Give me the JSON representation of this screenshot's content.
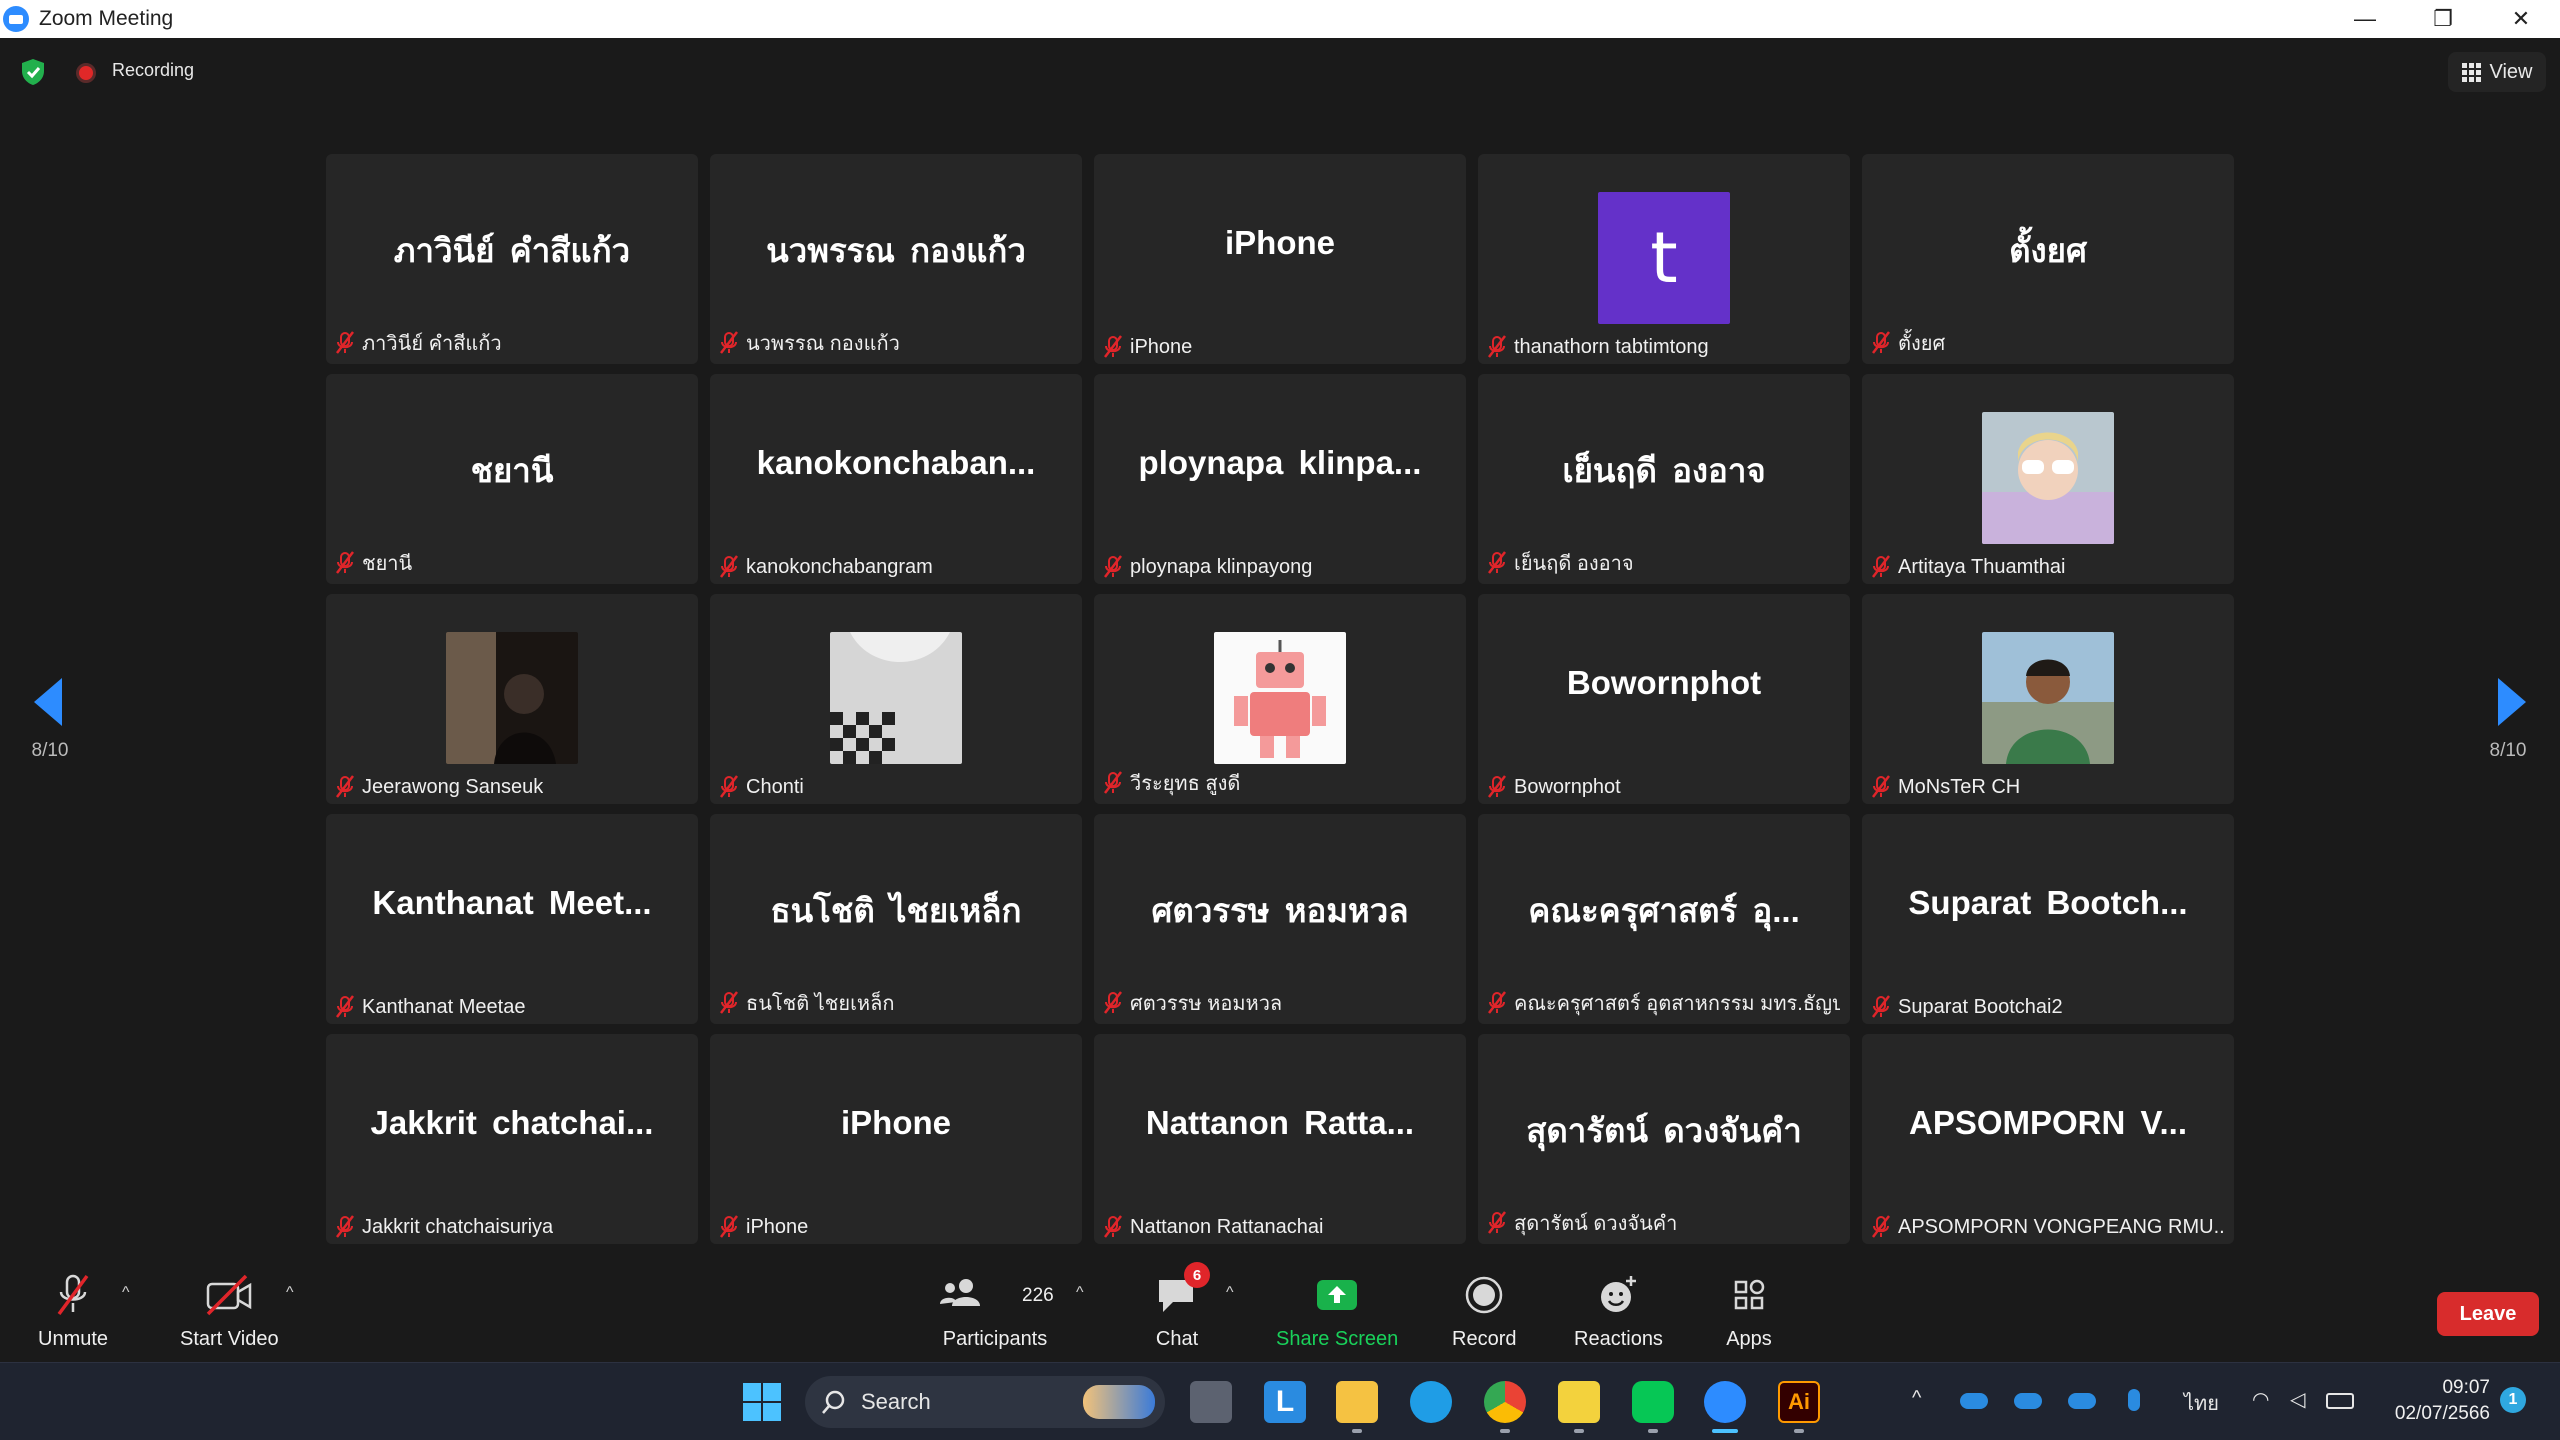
{
  "window": {
    "title": "Zoom Meeting",
    "minimize": "—",
    "restore": "❐",
    "close": "✕"
  },
  "meeting": {
    "recording_label": "Recording",
    "view_label": "View"
  },
  "pager": {
    "left": "8/10",
    "right": "8/10"
  },
  "tiles": [
    {
      "big": "ภาวินีย์ คำสีแก้ว",
      "name": "ภาวินีย์ คำสีแก้ว"
    },
    {
      "big": "นวพรรณ กองแก้ว",
      "name": "นวพรรณ กองแก้ว"
    },
    {
      "big": "iPhone",
      "name": "iPhone"
    },
    {
      "big": "",
      "name": "thanathorn tabtimtong",
      "avatar_letter": "t"
    },
    {
      "big": "ตั้งยศ",
      "name": "ตั้งยศ"
    },
    {
      "big": "ชยานี",
      "name": "ชยานี"
    },
    {
      "big": "kanokonchaban...",
      "name": "kanokonchabangram"
    },
    {
      "big": "ploynapa klinpa...",
      "name": "ploynapa klinpayong"
    },
    {
      "big": "เย็นฤดี องอาจ",
      "name": "เย็นฤดี องอาจ"
    },
    {
      "big": "",
      "name": "Artitaya Thuamthai",
      "photo": "photo-girl"
    },
    {
      "big": "",
      "name": "Jeerawong Sanseuk",
      "photo": "photo-dark"
    },
    {
      "big": "",
      "name": "Chonti",
      "photo": "photo-check"
    },
    {
      "big": "",
      "name": "วีระยุทธ สูงดี",
      "photo": "photo-robot"
    },
    {
      "big": "Bowornphot",
      "name": "Bowornphot"
    },
    {
      "big": "",
      "name": "MoNsTeR CH",
      "photo": "photo-man"
    },
    {
      "big": "Kanthanat Meet...",
      "name": "Kanthanat Meetae"
    },
    {
      "big": "ธนโชติ ไชยเหล็ก",
      "name": "ธนโชติ ไชยเหล็ก"
    },
    {
      "big": "ศตวรรษ หอมหวล",
      "name": "ศตวรรษ หอมหวล"
    },
    {
      "big": "คณะครุศาสตร์ อุ...",
      "name": "คณะครุศาสตร์ อุตสาหกรรม มทร.ธัญบุรี"
    },
    {
      "big": "Suparat Bootch...",
      "name": "Suparat Bootchai2"
    },
    {
      "big": "Jakkrit chatchai...",
      "name": "Jakkrit chatchaisuriya"
    },
    {
      "big": "iPhone",
      "name": "iPhone"
    },
    {
      "big": "Nattanon Ratta...",
      "name": "Nattanon Rattanachai"
    },
    {
      "big": "สุดารัตน์ ดวงจันคำ",
      "name": "สุดารัตน์ ดวงจันคำ"
    },
    {
      "big": "APSOMPORN V...",
      "name": "APSOMPORN VONGPEANG RMU..."
    }
  ],
  "toolbar": {
    "unmute": "Unmute",
    "start_video": "Start Video",
    "participants": "Participants",
    "participants_count": "226",
    "chat": "Chat",
    "chat_badge": "6",
    "share_screen": "Share Screen",
    "record": "Record",
    "reactions": "Reactions",
    "apps": "Apps",
    "leave": "Leave"
  },
  "taskbar": {
    "search_label": "Search",
    "lang": "ไทย",
    "time": "09:07",
    "date": "02/07/2566",
    "notification_count": "1"
  },
  "colors": {
    "accent": "#2d8cff",
    "share": "#19b24b",
    "leave": "#d82c2c",
    "avatar": "#6431c9",
    "muted": "#e0252a"
  }
}
